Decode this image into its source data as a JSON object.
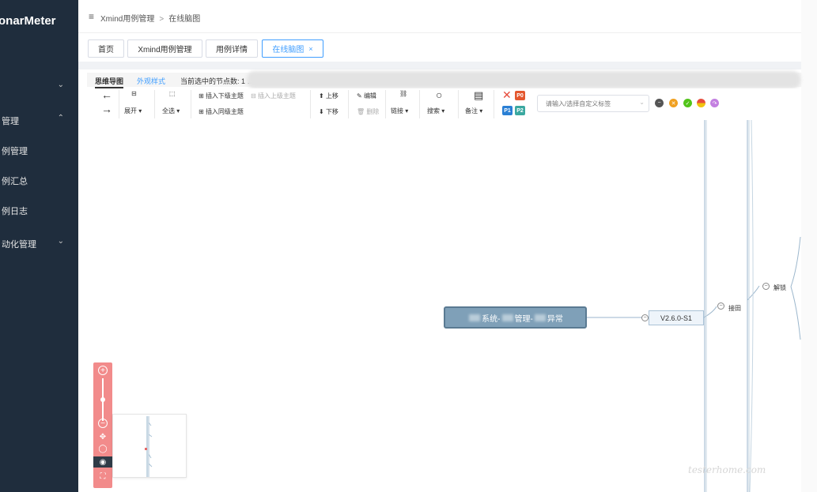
{
  "app": {
    "logo_text": "onarMeter"
  },
  "sidebar": {
    "items": [
      {
        "label": "",
        "chevron": "⌄"
      },
      {
        "label": "管理",
        "chevron": "⌃"
      },
      {
        "label": "例管理",
        "chevron": ""
      },
      {
        "label": "例汇总",
        "chevron": ""
      },
      {
        "label": "例日志",
        "chevron": ""
      },
      {
        "label": "动化管理",
        "chevron": "⌄"
      }
    ]
  },
  "header": {
    "menu_icon": "≡",
    "breadcrumb": [
      "Xmind用例管理",
      "在线脑图"
    ],
    "breadcrumb_sep": ">"
  },
  "tabs": [
    {
      "label": "首页"
    },
    {
      "label": "Xmind用例管理"
    },
    {
      "label": "用例详情"
    },
    {
      "label": "在线脑图",
      "close": "×"
    }
  ],
  "editor": {
    "subtabs": [
      "思维导图",
      "外观样式",
      "当前选中的节点数: 1 …"
    ],
    "toolbar": {
      "expand": "展开",
      "select_all": "全选",
      "insert_child": "插入下级主题",
      "insert_parent": "插入上级主题",
      "insert_sibling": "插入同级主题",
      "move_up": "上移",
      "move_down": "下移",
      "edit": "编辑",
      "delete": "删除",
      "link": "链接",
      "search": "搜索",
      "note": "备注",
      "priorities": [
        "P0",
        "P1",
        "P2"
      ],
      "tag_placeholder": "请输入/选择自定义标签"
    },
    "status_colors": [
      "#555555",
      "#f0a020",
      "#52c41a",
      "#e0a000",
      "#c37fe0"
    ]
  },
  "mindmap": {
    "root_label_parts": [
      "系统-",
      "管理-",
      "异常"
    ],
    "child_label": "V2.6.0-S1",
    "branch_labels": [
      "接田",
      "解锁"
    ]
  },
  "zoom": {
    "plus": "+",
    "minus": "−",
    "move_icon": "✥",
    "target_icon": "◯",
    "eye_icon": "◉",
    "fit_icon": "⛶"
  },
  "watermark": "testerhome.com"
}
